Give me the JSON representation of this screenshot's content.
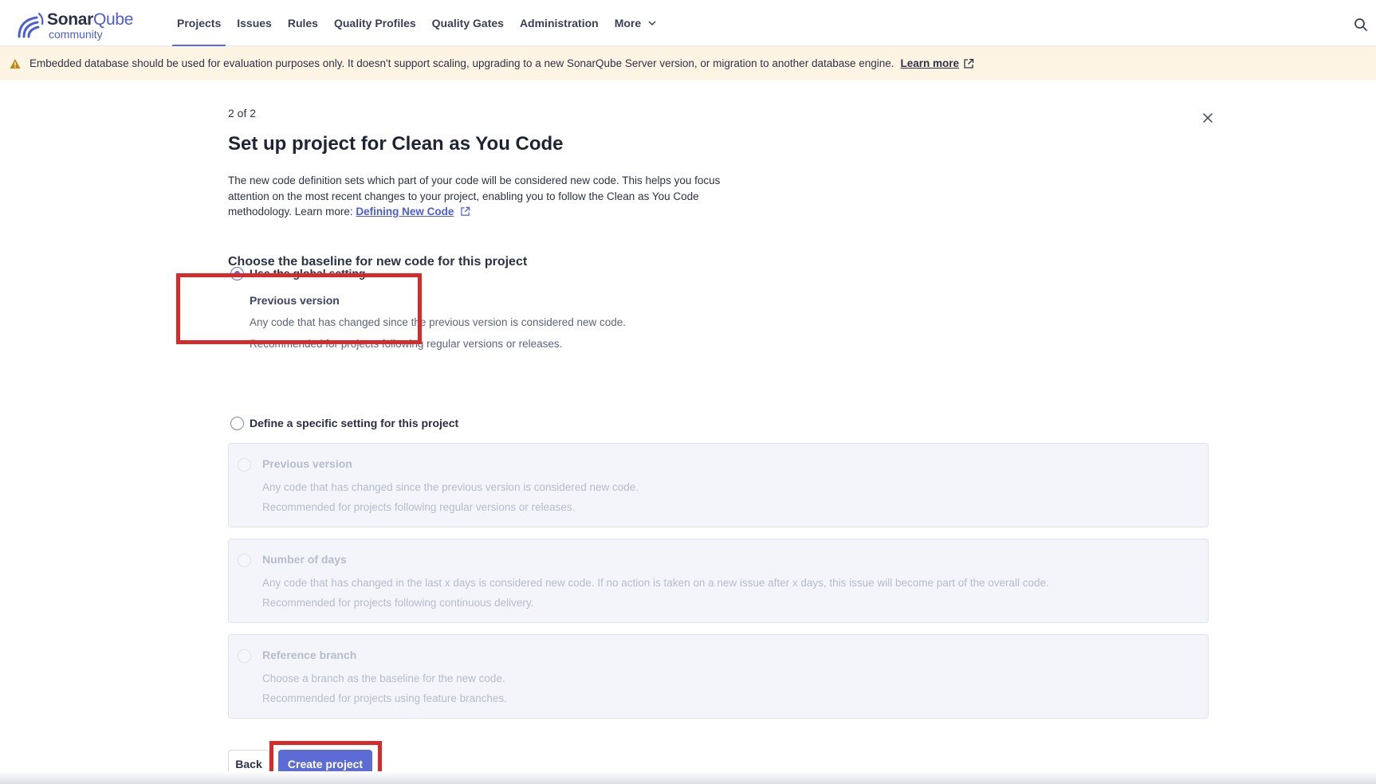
{
  "header": {
    "logo_word": "Sonar",
    "logo_word_accent": "Qube",
    "logo_subtitle": "community",
    "nav": [
      {
        "label": "Projects",
        "active": true
      },
      {
        "label": "Issues",
        "active": false
      },
      {
        "label": "Rules",
        "active": false
      },
      {
        "label": "Quality Profiles",
        "active": false
      },
      {
        "label": "Quality Gates",
        "active": false
      },
      {
        "label": "Administration",
        "active": false
      },
      {
        "label": "More",
        "active": false
      }
    ],
    "search_icon": "search-icon"
  },
  "banner": {
    "text": "Embedded database should be used for evaluation purposes only. It doesn't support scaling, upgrading to a new SonarQube Server version, or migration to another database engine.",
    "link": "Learn more",
    "icon": "warning-icon"
  },
  "wizard": {
    "step": "2 of 2",
    "title": "Set up project for Clean as You Code",
    "description": "The new code definition sets which part of your code will be considered new code. This helps you focus attention on the most recent changes to your project, enabling you to follow the Clean as You Code methodology. Learn more:",
    "description_link": "Defining New Code",
    "section_title": "Choose the baseline for new code for this project",
    "global_option": {
      "label": "Use the global setting",
      "selected": true,
      "sub_label": "Previous version",
      "line1": "Any code that has changed since the previous version is considered new code.",
      "line2": "Recommended for projects following regular versions or releases."
    },
    "specific_option": {
      "label": "Define a specific setting for this project",
      "selected": false
    },
    "cards": [
      {
        "title": "Previous version",
        "line1": "Any code that has changed since the previous version is considered new code.",
        "line2": "Recommended for projects following regular versions or releases."
      },
      {
        "title": "Number of days",
        "line1": "Any code that has changed in the last x days is considered new code. If no action is taken on a new issue after x days, this issue will become part of the overall code.",
        "line2": "Recommended for projects following continuous delivery."
      },
      {
        "title": "Reference branch",
        "line1": "Choose a branch as the baseline for the new code.",
        "line2": "Recommended for projects using feature branches."
      }
    ],
    "back_label": "Back",
    "create_label": "Create project"
  },
  "colors": {
    "accent": "#5d6cd4",
    "banner_bg": "#fdf4e3",
    "highlight": "#d62b2b",
    "card_bg": "#f3f5fb"
  }
}
